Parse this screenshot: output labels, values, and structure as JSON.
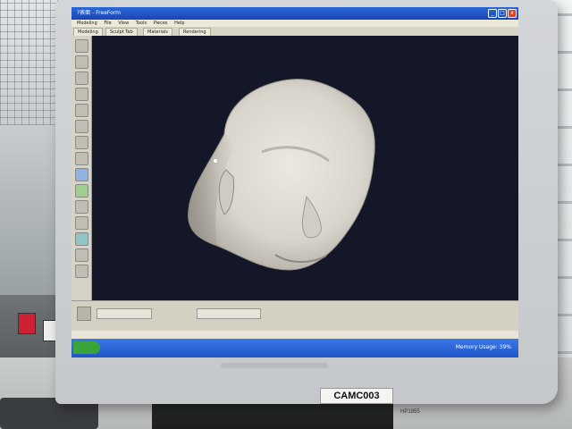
{
  "app": {
    "window_title": "?表面 - FreeForm",
    "menu": [
      "Modeling",
      "File",
      "View",
      "Tools",
      "Pieces",
      "Help"
    ],
    "tabs": [
      "Modeling",
      "Sculpt Tab",
      "Materials",
      "Rendering"
    ]
  },
  "viewport": {
    "background": "#141727",
    "model": "clay-head-sculpt"
  },
  "taskbar": {
    "memory_label": "Memory Usage: 39%"
  },
  "labels": {
    "asset_tag": "CAMC003",
    "model_number": "HP1955"
  },
  "colors": {
    "titlebar": "#1f55c9",
    "clay": "#d9d5cc"
  }
}
